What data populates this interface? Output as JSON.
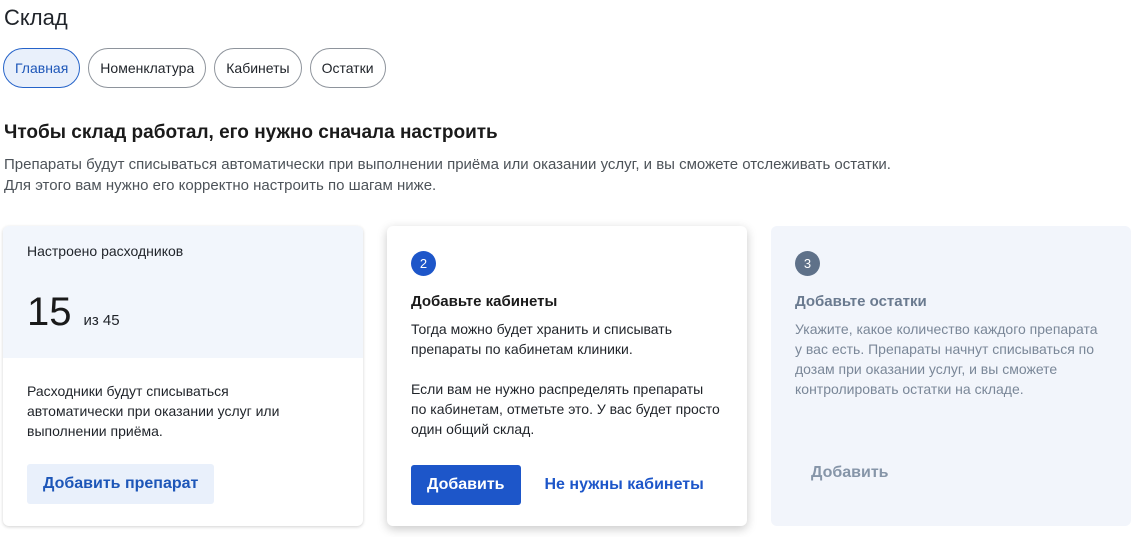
{
  "page": {
    "title": "Склад"
  },
  "tabs": [
    {
      "label": "Главная",
      "active": true
    },
    {
      "label": "Номенклатура",
      "active": false
    },
    {
      "label": "Кабинеты",
      "active": false
    },
    {
      "label": "Остатки",
      "active": false
    }
  ],
  "intro": {
    "heading": "Чтобы склад работал, его нужно сначала настроить",
    "line1": "Препараты будут списываться автоматически при выполнении приёма или оказании услуг, и вы сможете отслеживать остатки.",
    "line2": "Для этого вам нужно его корректно настроить по шагам ниже."
  },
  "card1": {
    "label": "Настроено расходников",
    "count": "15",
    "of": "из 45",
    "text": "Расходники будут списываться автоматически при оказании услуг или выполнении приёма.",
    "button": "Добавить препарат"
  },
  "card2": {
    "step": "2",
    "title": "Добавьте кабинеты",
    "text1": "Тогда можно будет хранить и списывать препараты по кабинетам клиники.",
    "text2": "Если вам не нужно распределять препараты по кабинетам, отметьте это. У вас будет просто один общий склад.",
    "primary_button": "Добавить",
    "link_button": "Не нужны кабинеты"
  },
  "card3": {
    "step": "3",
    "title": "Добавьте остатки",
    "text": "Укажите, какое количество каждого препарата у вас есть. Препараты начнут списываться по дозам при оказании услуг, и вы сможете контролировать остатки на складе.",
    "button": "Добавить"
  },
  "colors": {
    "accent": "#1d56c9",
    "accent_light_bg": "#e9f0fb",
    "disabled_step": "#5f7189"
  }
}
